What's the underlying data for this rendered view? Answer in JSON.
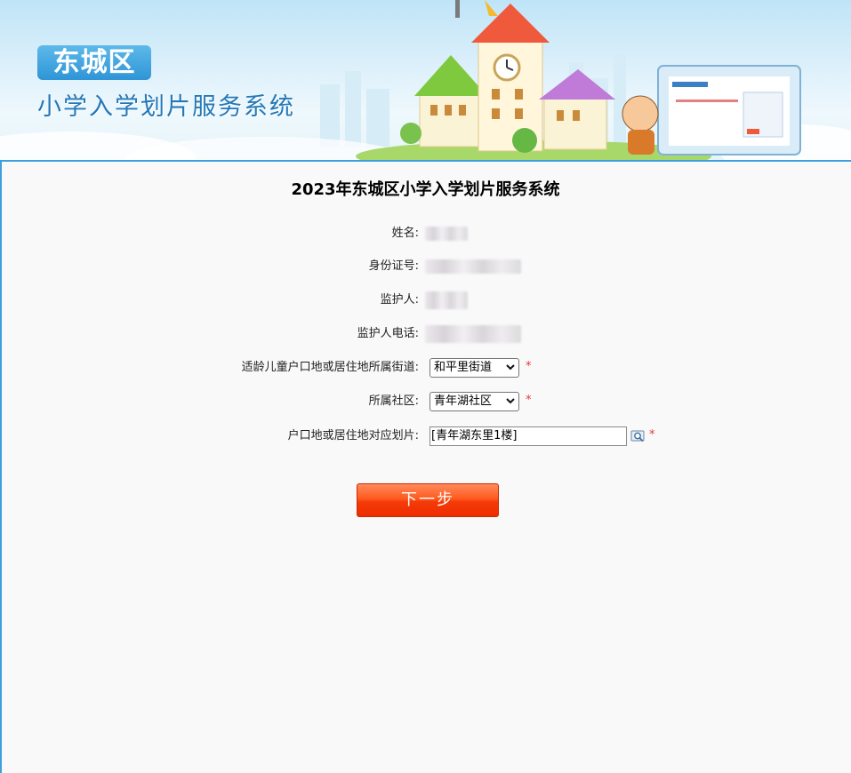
{
  "banner": {
    "district": "东城区",
    "subtitle": "小学入学划片服务系统"
  },
  "page_title": "2023年东城区小学入学划片服务系统",
  "form": {
    "name_label": "姓名:",
    "id_label": "身份证号:",
    "guardian_label": "监护人:",
    "guardian_phone_label": "监护人电话:",
    "street_label": "适龄儿童户口地或居住地所属街道:",
    "street_value": "和平里街道",
    "community_label": "所属社区:",
    "community_value": "青年湖社区",
    "zone_label": "户口地或居住地对应划片:",
    "zone_value": "[青年湖东里1楼]",
    "required_mark": "*"
  },
  "next_button_label": "下一步",
  "colors": {
    "accent": "#3da0dc",
    "button": "#f43b09",
    "required": "#e33333"
  },
  "icons": [
    "chevron-down-icon",
    "lookup-icon"
  ]
}
